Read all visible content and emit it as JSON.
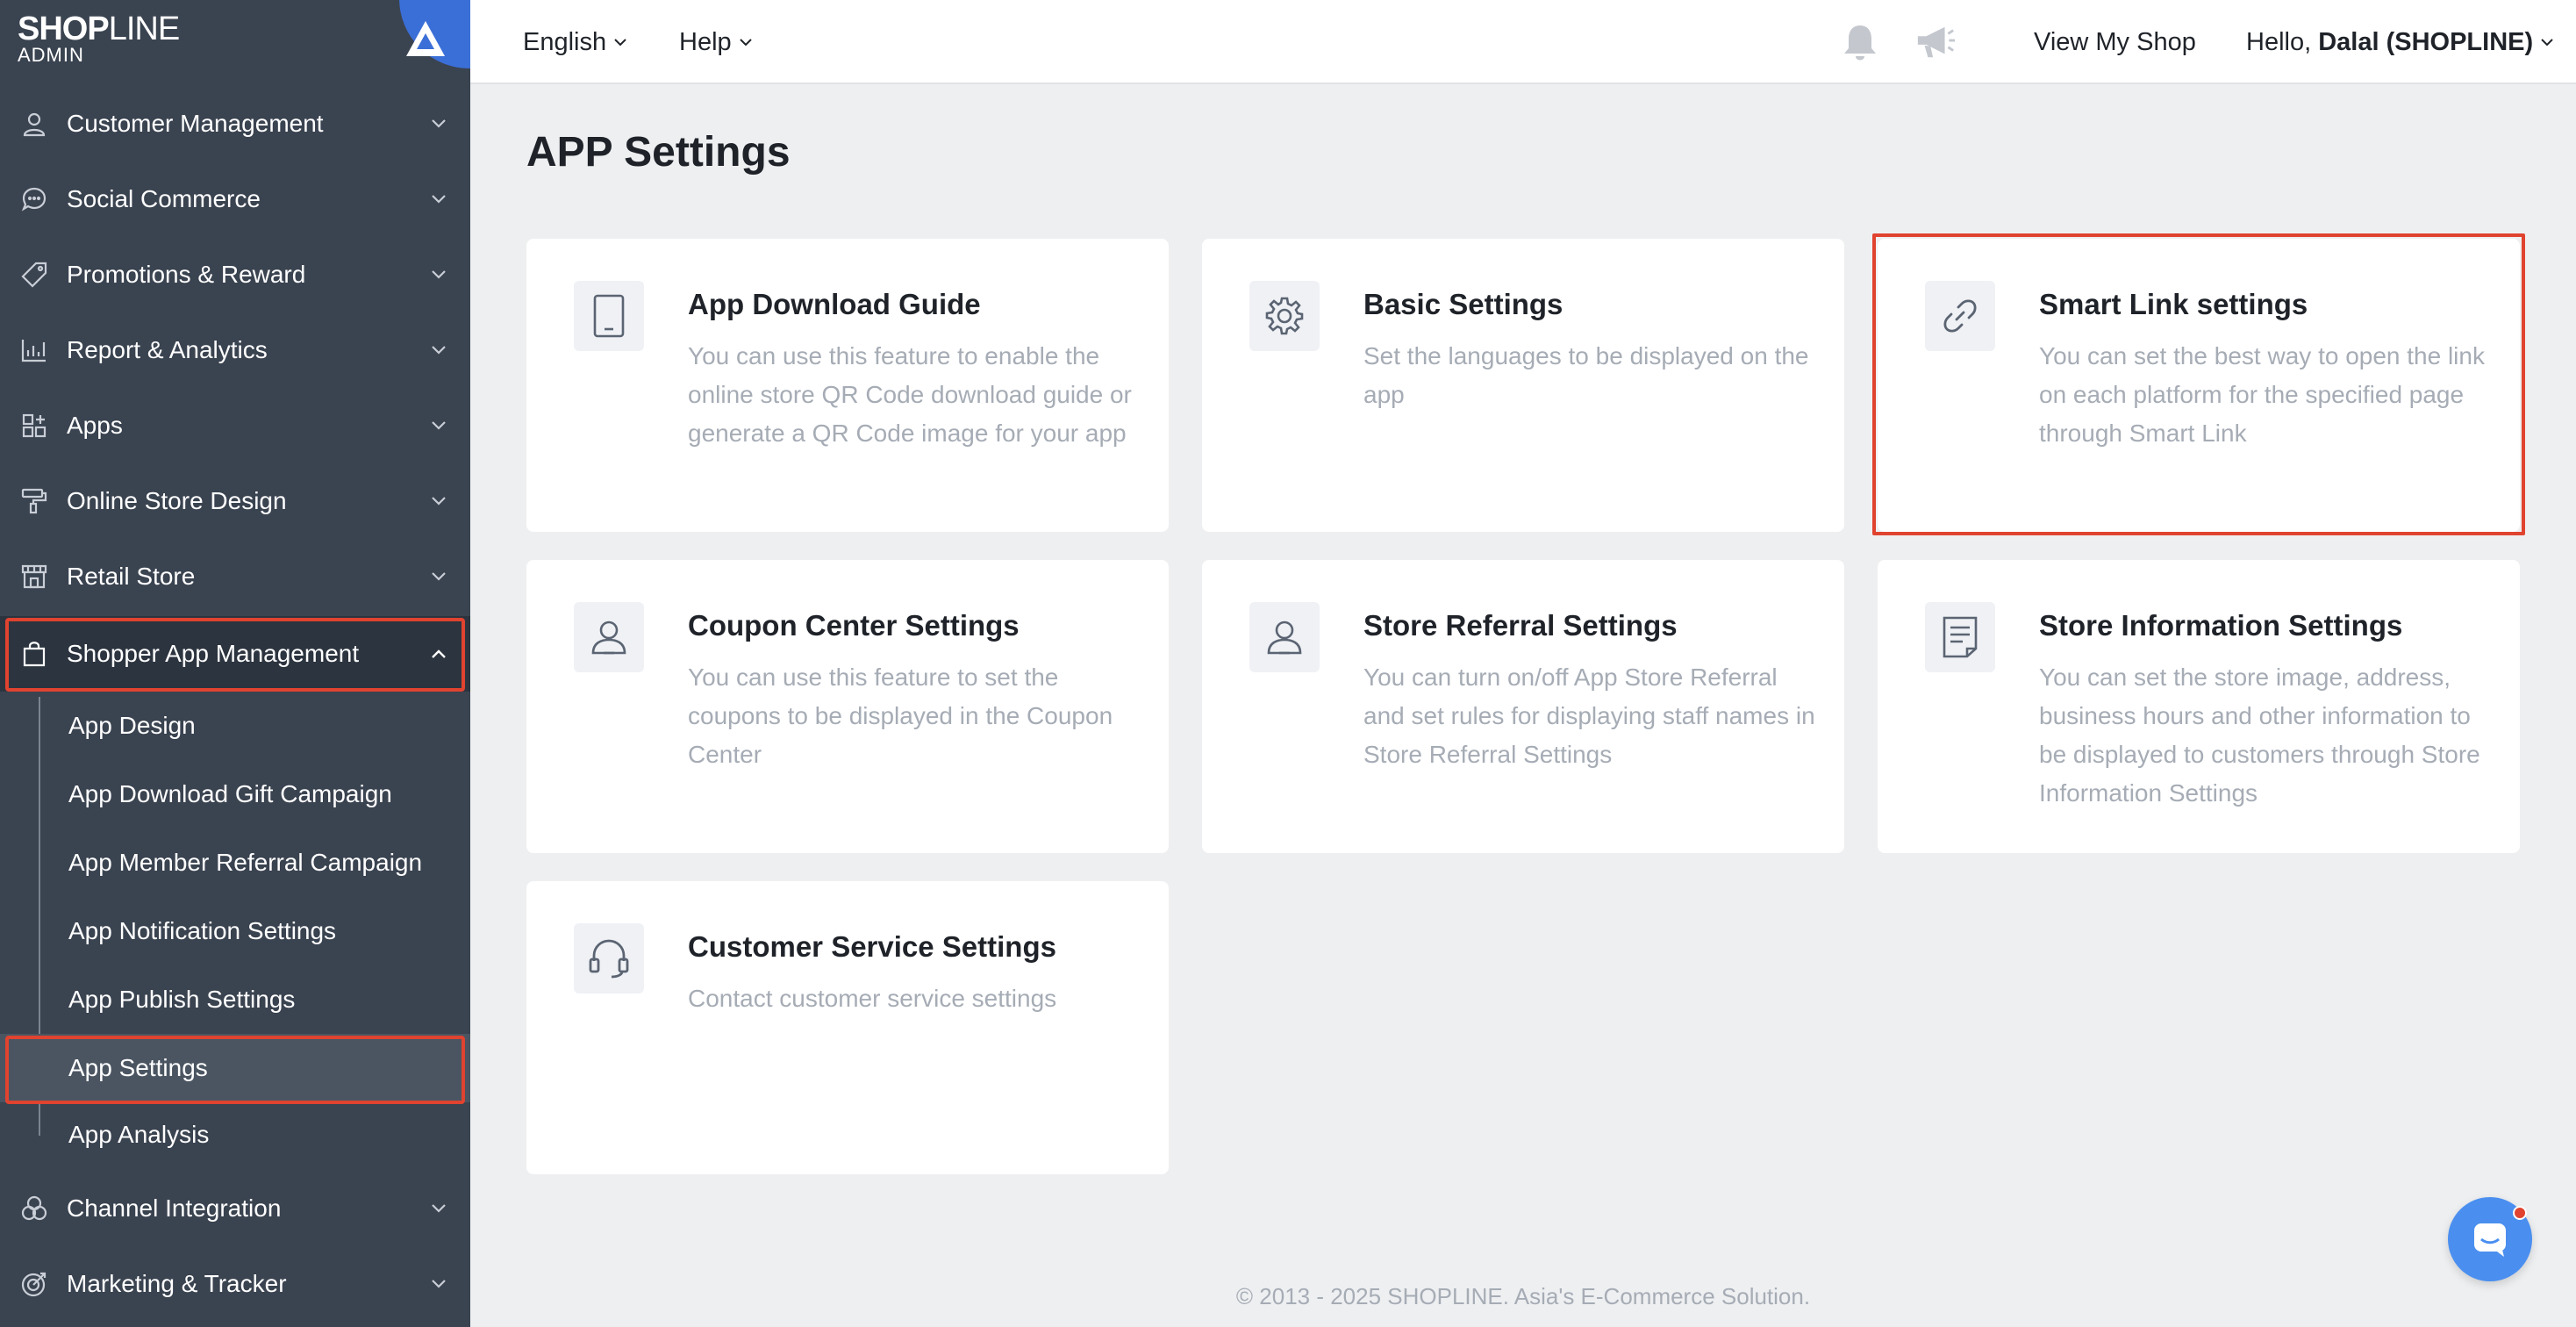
{
  "logo": {
    "brand_bold": "SHOP",
    "brand_light": "LINE",
    "sub": "ADMIN"
  },
  "sidebar": {
    "items": [
      {
        "label": "Customer Management",
        "icon": "user-icon"
      },
      {
        "label": "Social Commerce",
        "icon": "chat-bubble-icon"
      },
      {
        "label": "Promotions & Reward",
        "icon": "tag-icon"
      },
      {
        "label": "Report & Analytics",
        "icon": "bar-chart-icon"
      },
      {
        "label": "Apps",
        "icon": "apps-grid-icon"
      },
      {
        "label": "Online Store Design",
        "icon": "paint-roller-icon"
      },
      {
        "label": "Retail Store",
        "icon": "store-icon"
      },
      {
        "label": "Shopper App Management",
        "icon": "shopping-bag-icon"
      },
      {
        "label": "Channel Integration",
        "icon": "channels-icon"
      },
      {
        "label": "Marketing & Tracker",
        "icon": "target-icon"
      }
    ],
    "sub_items": [
      {
        "label": "App Design"
      },
      {
        "label": "App Download Gift Campaign"
      },
      {
        "label": "App Member Referral Campaign"
      },
      {
        "label": "App Notification Settings"
      },
      {
        "label": "App Publish Settings"
      },
      {
        "label": "App Settings"
      },
      {
        "label": "App Analysis"
      }
    ]
  },
  "topbar": {
    "language": "English",
    "help": "Help",
    "view_shop": "View My Shop",
    "hello_prefix": "Hello, ",
    "user_name": "Dalal (SHOPLINE)"
  },
  "main": {
    "title": "APP Settings",
    "cards": [
      {
        "title": "App Download Guide",
        "desc": "You can use this feature to enable the online store QR Code download guide or generate a QR Code image for your app",
        "icon": "tablet-icon"
      },
      {
        "title": "Basic Settings",
        "desc": "Set the languages to be displayed on the app",
        "icon": "gear-icon"
      },
      {
        "title": "Smart Link settings",
        "desc": "You can set the best way to open the link on each platform for the specified page through Smart Link",
        "icon": "link-icon"
      },
      {
        "title": "Coupon Center Settings",
        "desc": "You can use this feature to set the coupons to be displayed in the Coupon Center",
        "icon": "user-card-icon"
      },
      {
        "title": "Store Referral Settings",
        "desc": "You can turn on/off App Store Referral and set rules for displaying staff names in Store Referral Settings",
        "icon": "user-card-icon"
      },
      {
        "title": "Store Information Settings",
        "desc": "You can set the store image, address, business hours and other information to be displayed to customers through Store Information Settings",
        "icon": "document-icon"
      },
      {
        "title": "Customer Service Settings",
        "desc": "Contact customer service settings",
        "icon": "headset-icon"
      }
    ]
  },
  "footer": "© 2013 - 2025  SHOPLINE. Asia's E-Commerce Solution.",
  "colors": {
    "sidebar_bg": "#3a4350",
    "highlight": "#e0432f",
    "accent": "#3b6fd8",
    "chat": "#4a8ff0"
  }
}
